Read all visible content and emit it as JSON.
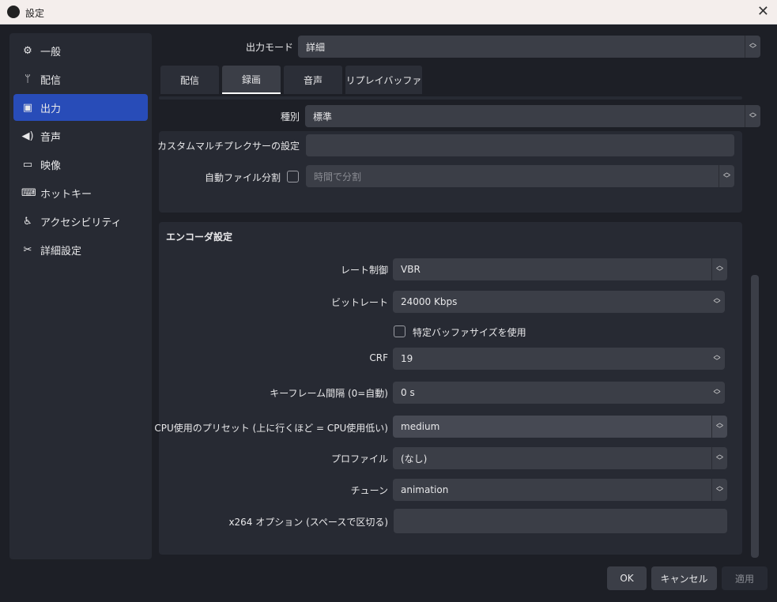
{
  "window": {
    "title": "設定"
  },
  "sidebar": {
    "items": [
      {
        "label": "一般",
        "icon": "gear-icon"
      },
      {
        "label": "配信",
        "icon": "antenna-icon"
      },
      {
        "label": "出力",
        "icon": "output-icon"
      },
      {
        "label": "音声",
        "icon": "speaker-icon"
      },
      {
        "label": "映像",
        "icon": "monitor-icon"
      },
      {
        "label": "ホットキー",
        "icon": "keyboard-icon"
      },
      {
        "label": "アクセシビリティ",
        "icon": "accessibility-icon"
      },
      {
        "label": "詳細設定",
        "icon": "tools-icon"
      }
    ]
  },
  "output_mode": {
    "label": "出力モード",
    "value": "詳細"
  },
  "tabs": [
    "配信",
    "録画",
    "音声",
    "リプレイバッファ"
  ],
  "recording": {
    "type_label": "種別",
    "type_value": "標準",
    "muxer_label": "カスタムマルチプレクサーの設定",
    "muxer_value": "",
    "split_label": "自動ファイル分割",
    "split_placeholder": "時間で分割"
  },
  "encoder": {
    "title": "エンコーダ設定",
    "rate_control_label": "レート制御",
    "rate_control": "VBR",
    "bitrate_label": "ビットレート",
    "bitrate": "24000 Kbps",
    "buffer_label": "特定バッファサイズを使用",
    "crf_label": "CRF",
    "crf": "19",
    "keyframe_label": "キーフレーム間隔 (0=自動)",
    "keyframe": "0 s",
    "preset_label": "CPU使用のプリセット (上に行くほど = CPU使用低い)",
    "preset": "medium",
    "profile_label": "プロファイル",
    "profile": "(なし)",
    "tune_label": "チューン",
    "tune": "animation",
    "options_label": "x264 オプション (スペースで区切る)",
    "options": ""
  },
  "buttons": {
    "ok": "OK",
    "cancel": "キャンセル",
    "apply": "適用"
  }
}
